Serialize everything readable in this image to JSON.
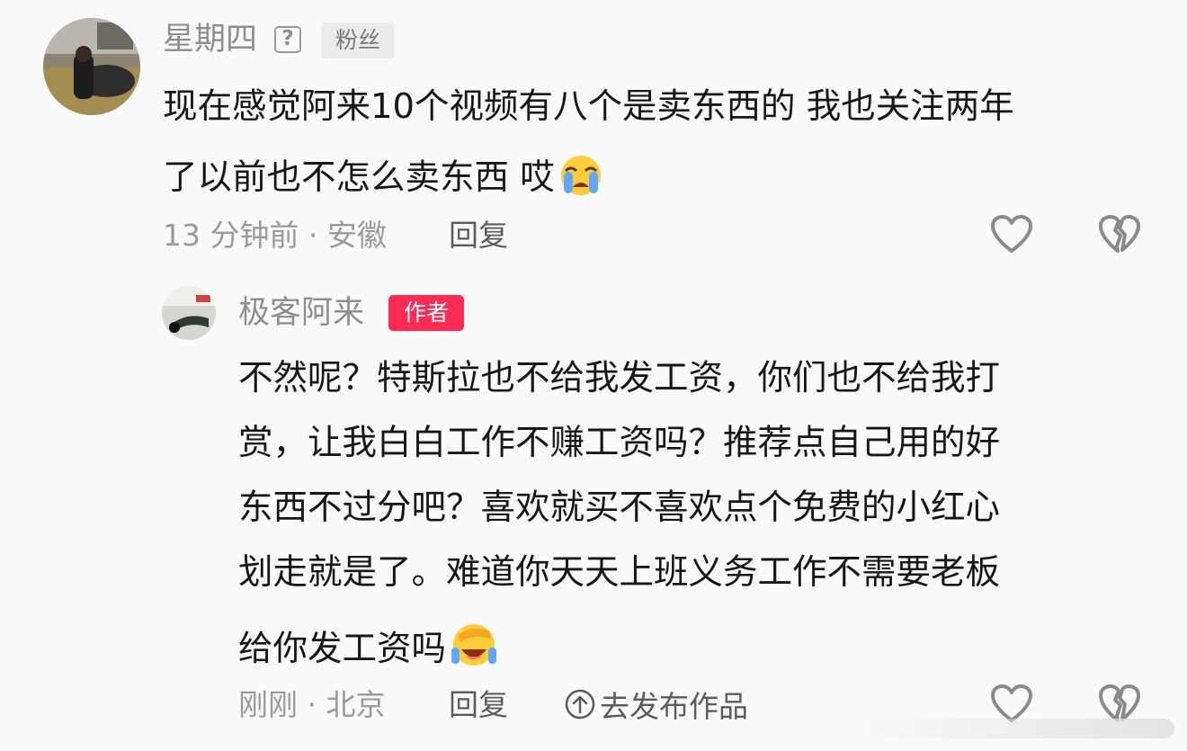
{
  "comment": {
    "username": "星期四",
    "help_mark": "?",
    "badge": "粉丝",
    "text_line1": "现在感觉阿来10个视频有八个是卖东西的 我也关注两年",
    "text_line2": "了以前也不怎么卖东西 哎",
    "emoji_icon": "crying-face-icon",
    "meta": "13 分钟前 · 安徽",
    "reply_label": "回复"
  },
  "reply": {
    "username": "极客阿来",
    "badge": "作者",
    "lines": [
      "不然呢？特斯拉也不给我发工资，你们也不给我打",
      "赏，让我白白工作不赚工资吗？推荐点自己用的好",
      "东西不过分吧？喜欢就买不喜欢点个免费的小红心",
      "划走就是了。难道你天天上班义务工作不需要老板",
      "给你发工资吗"
    ],
    "emoji_icon": "facepalm-laughing-icon",
    "meta": "刚刚 · 北京",
    "reply_label": "回复",
    "publish_label": "去发布作品"
  },
  "colors": {
    "author_badge": "#fe2c55",
    "fan_badge_bg": "#ececec",
    "page_bg": "#fafafa"
  }
}
